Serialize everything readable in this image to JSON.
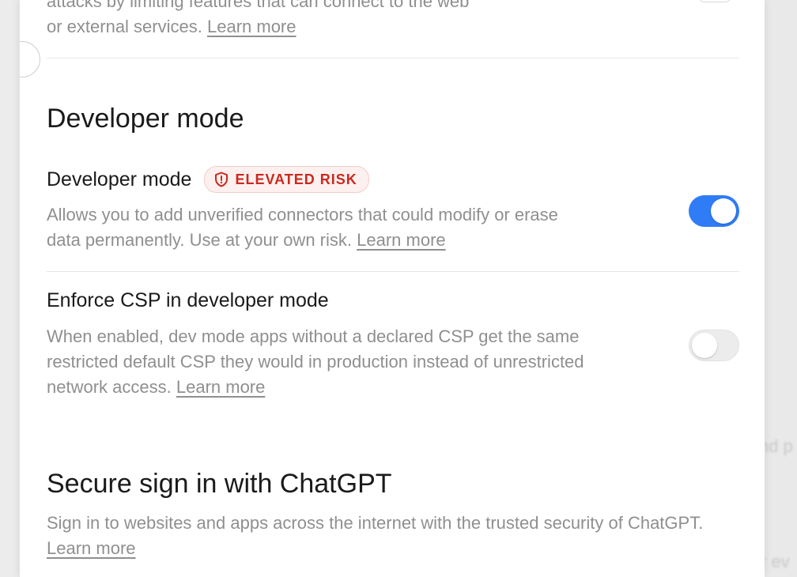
{
  "network_section": {
    "description_tail": "attacks by limiting features that can connect to the web or external services.",
    "learn_more": "Learn more"
  },
  "developer_section": {
    "title": "Developer mode",
    "developer_mode": {
      "label": "Developer mode",
      "badge": "ELEVATED RISK",
      "description": "Allows you to add unverified connectors that could modify or erase data permanently. Use at your own risk.",
      "learn_more": "Learn more",
      "enabled": true
    },
    "enforce_csp": {
      "label": "Enforce CSP in developer mode",
      "description": "When enabled, dev mode apps without a declared CSP get the same restricted default CSP they would in production instead of unrestricted network access.",
      "learn_more": "Learn more",
      "enabled": false
    }
  },
  "secure_signin_section": {
    "title": "Secure sign in with ChatGPT",
    "description": "Sign in to websites and apps across the internet with the trusted security of ChatGPT.",
    "learn_more": "Learn more"
  },
  "background": {
    "ghost_text_1": "nd p",
    "ghost_text_2": "r ev"
  },
  "colors": {
    "toggle_on": "#2f7cf6",
    "badge_text": "#c92a1e",
    "badge_bg": "#fdf0ef",
    "muted_text": "#8f8f8f"
  },
  "icons": {
    "badge_icon": "shield-alert-icon"
  }
}
